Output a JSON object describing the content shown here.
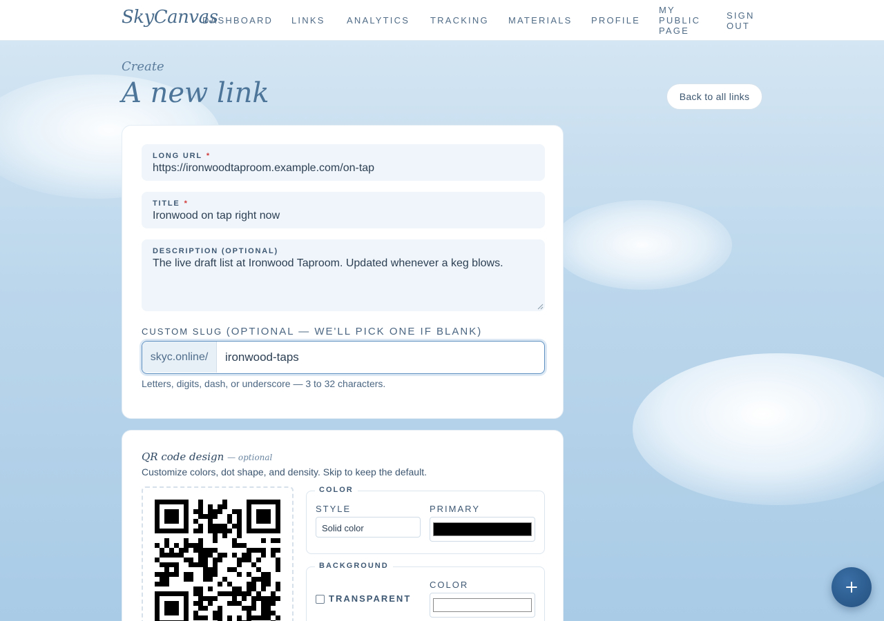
{
  "brand": {
    "logo": "SkyCanvas"
  },
  "nav": {
    "dashboard": "DASHBOARD",
    "links": "LINKS",
    "analytics": "ANALYTICS",
    "tracking": "TRACKING",
    "materials": "MATERIALS",
    "profile": "PROFILE",
    "public_page_line1": "MY",
    "public_page_line2": "PUBLIC",
    "public_page_line3": "PAGE",
    "sign_out_line1": "SIGN",
    "sign_out_line2": "OUT"
  },
  "header": {
    "eyebrow": "Create",
    "title": "A new link",
    "back_button": "Back to all links"
  },
  "form": {
    "long_url": {
      "label": "LONG URL",
      "required": "*",
      "value": "https://ironwoodtaproom.example.com/on-tap"
    },
    "title": {
      "label": "TITLE",
      "required": "*",
      "value": "Ironwood on tap right now"
    },
    "description": {
      "label": "DESCRIPTION (OPTIONAL)",
      "value": "The live draft list at Ironwood Taproom. Updated whenever a keg blows."
    },
    "slug": {
      "label": "CUSTOM SLUG",
      "label_optional": "(OPTIONAL — WE'LL PICK ONE IF BLANK)",
      "prefix": "skyc.online/",
      "value": "ironwood-taps",
      "hint": "Letters, digits, dash, or underscore — 3 to 32 characters."
    }
  },
  "qr": {
    "title": "QR code design",
    "title_sub": "— optional",
    "description": "Customize colors, dot shape, and density. Skip to keep the default.",
    "color": {
      "legend": "COLOR",
      "style_label": "STYLE",
      "style_value": "Solid color",
      "primary_label": "PRIMARY",
      "primary_color": "#000000"
    },
    "background": {
      "legend": "BACKGROUND",
      "transparent_label": "TRANSPARENT",
      "transparent_checked": false,
      "color_label": "COLOR",
      "color_value": "#ffffff"
    }
  },
  "fab": {
    "icon": "plus-icon"
  }
}
